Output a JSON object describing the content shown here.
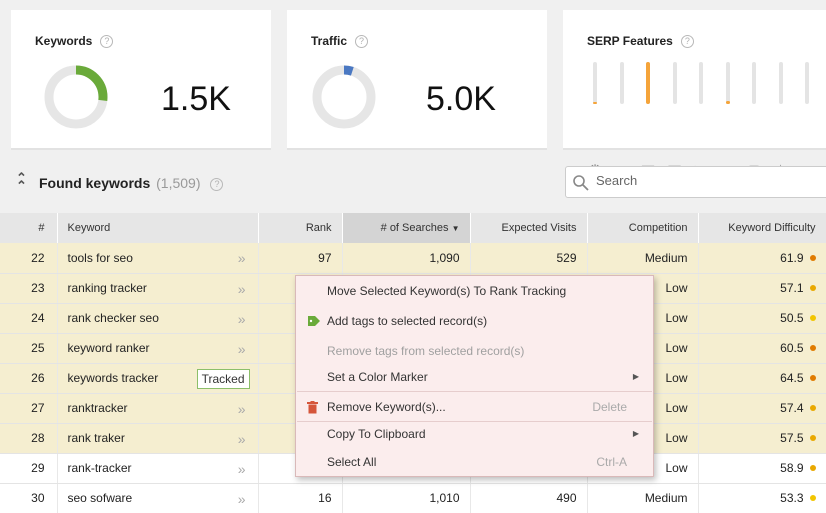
{
  "cards": {
    "keywords": {
      "title": "Keywords",
      "value": "1.5K",
      "ratio": 0.27,
      "color": "#6aaa3a"
    },
    "traffic": {
      "title": "Traffic",
      "value": "5.0K",
      "ratio": 0.05,
      "color": "#4a78c2"
    },
    "serp": {
      "title": "SERP Features",
      "bars": [
        0.05,
        0.0,
        1.0,
        0.0,
        0.0,
        0.08,
        0.0,
        0.0,
        0.0
      ],
      "icons": [
        "crown-icon",
        "map-pin-icon",
        "image-icon",
        "news-icon",
        "video-icon",
        "link-icon",
        "card-icon",
        "star-icon",
        "graduation-cap-icon"
      ]
    }
  },
  "section": {
    "title": "Found keywords",
    "count": "(1,509)"
  },
  "search": {
    "placeholder": "Search"
  },
  "table": {
    "headers": {
      "num": "#",
      "keyword": "Keyword",
      "rank": "Rank",
      "searches": "# of Searches",
      "visits": "Expected Visits",
      "competition": "Competition",
      "difficulty": "Keyword Difficulty"
    },
    "rows": [
      {
        "num": "22",
        "keyword": "tools for seo",
        "rank": "97",
        "searches": "1,090",
        "visits": "529",
        "competition": "Medium",
        "difficulty": "61.9",
        "dot": "#e07b00",
        "hl": true
      },
      {
        "num": "23",
        "keyword": "ranking tracker",
        "rank": "",
        "searches": "",
        "visits": "",
        "competition": "Low",
        "difficulty": "57.1",
        "dot": "#e9a800",
        "hl": true
      },
      {
        "num": "24",
        "keyword": "rank checker seo",
        "rank": "",
        "searches": "",
        "visits": "",
        "competition": "Low",
        "difficulty": "50.5",
        "dot": "#f2c500",
        "hl": true
      },
      {
        "num": "25",
        "keyword": "keyword ranker",
        "rank": "",
        "searches": "",
        "visits": "",
        "competition": "Low",
        "difficulty": "60.5",
        "dot": "#e07b00",
        "hl": true
      },
      {
        "num": "26",
        "keyword": "keywords tracker",
        "rank": "",
        "searches": "",
        "visits": "",
        "competition": "Low",
        "difficulty": "64.5",
        "dot": "#e07b00",
        "hl": true,
        "tracked": "Tracked"
      },
      {
        "num": "27",
        "keyword": "ranktracker",
        "rank": "",
        "searches": "",
        "visits": "",
        "competition": "Low",
        "difficulty": "57.4",
        "dot": "#e9a800",
        "hl": true
      },
      {
        "num": "28",
        "keyword": "rank traker",
        "rank": "",
        "searches": "",
        "visits": "",
        "competition": "Low",
        "difficulty": "57.5",
        "dot": "#e9a800",
        "hl": true
      },
      {
        "num": "29",
        "keyword": "rank-tracker",
        "rank": "",
        "searches": "",
        "visits": "",
        "competition": "Low",
        "difficulty": "58.9",
        "dot": "#e9a800",
        "hl": false
      },
      {
        "num": "30",
        "keyword": "seo sofware",
        "rank": "16",
        "searches": "1,010",
        "visits": "490",
        "competition": "Medium",
        "difficulty": "53.3",
        "dot": "#f2c500",
        "hl": false
      }
    ]
  },
  "context_menu": {
    "move": "Move Selected Keyword(s) To Rank Tracking",
    "add_tags": "Add tags to selected record(s)",
    "remove_tags": "Remove tags from selected record(s)",
    "color_marker": "Set a Color Marker",
    "remove_kw": "Remove Keyword(s)...",
    "remove_kw_shortcut": "Delete",
    "copy": "Copy To Clipboard",
    "select_all": "Select All",
    "select_all_shortcut": "Ctrl-A"
  }
}
